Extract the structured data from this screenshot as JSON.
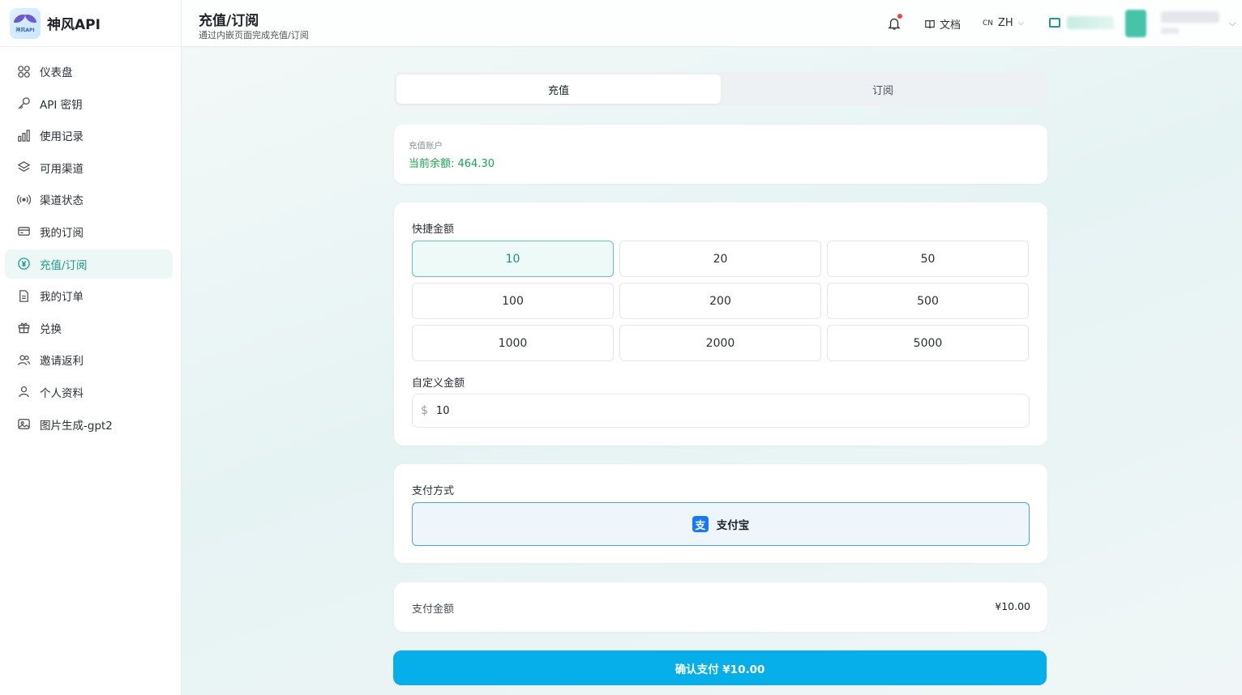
{
  "brand": {
    "name": "神风API",
    "logo_text": "神风API"
  },
  "sidebar": {
    "items": [
      {
        "label": "仪表盘",
        "icon": "dashboard-icon"
      },
      {
        "label": "API 密钥",
        "icon": "key-icon"
      },
      {
        "label": "使用记录",
        "icon": "bar-chart-icon"
      },
      {
        "label": "可用渠道",
        "icon": "layers-icon"
      },
      {
        "label": "渠道状态",
        "icon": "broadcast-icon"
      },
      {
        "label": "我的订阅",
        "icon": "card-icon"
      },
      {
        "label": "充值/订阅",
        "icon": "yen-circle-icon",
        "active": true
      },
      {
        "label": "我的订单",
        "icon": "document-icon"
      },
      {
        "label": "兑换",
        "icon": "gift-icon"
      },
      {
        "label": "邀请返利",
        "icon": "users-icon"
      },
      {
        "label": "个人资料",
        "icon": "user-icon"
      },
      {
        "label": "图片生成-gpt2",
        "icon": "image-gen-icon"
      }
    ]
  },
  "header": {
    "title": "充值/订阅",
    "subtitle": "通过内嵌页面完成充值/订阅",
    "docs_label": "文档",
    "lang_code": "CN",
    "lang_label": "ZH"
  },
  "tabs": [
    {
      "label": "充值",
      "active": true
    },
    {
      "label": "订阅",
      "active": false
    }
  ],
  "account": {
    "label": "充值账户",
    "balance_text": "当前余额: 464.30"
  },
  "amount": {
    "quick_label": "快捷金额",
    "options": [
      "10",
      "20",
      "50",
      "100",
      "200",
      "500",
      "1000",
      "2000",
      "5000"
    ],
    "selected": "10",
    "custom_label": "自定义金额",
    "currency_symbol": "$",
    "custom_value": "10"
  },
  "payment": {
    "label": "支付方式",
    "method": "支付宝",
    "method_icon": "alipay-icon"
  },
  "summary": {
    "label": "支付金额",
    "value": "¥10.00"
  },
  "confirm_label": "确认支付 ¥10.00",
  "colors": {
    "accent": "#1a9c87",
    "balance": "#16a34a",
    "confirm": "#06aeea",
    "alipay": "#1677ff",
    "notification_dot": "#ef4444"
  }
}
